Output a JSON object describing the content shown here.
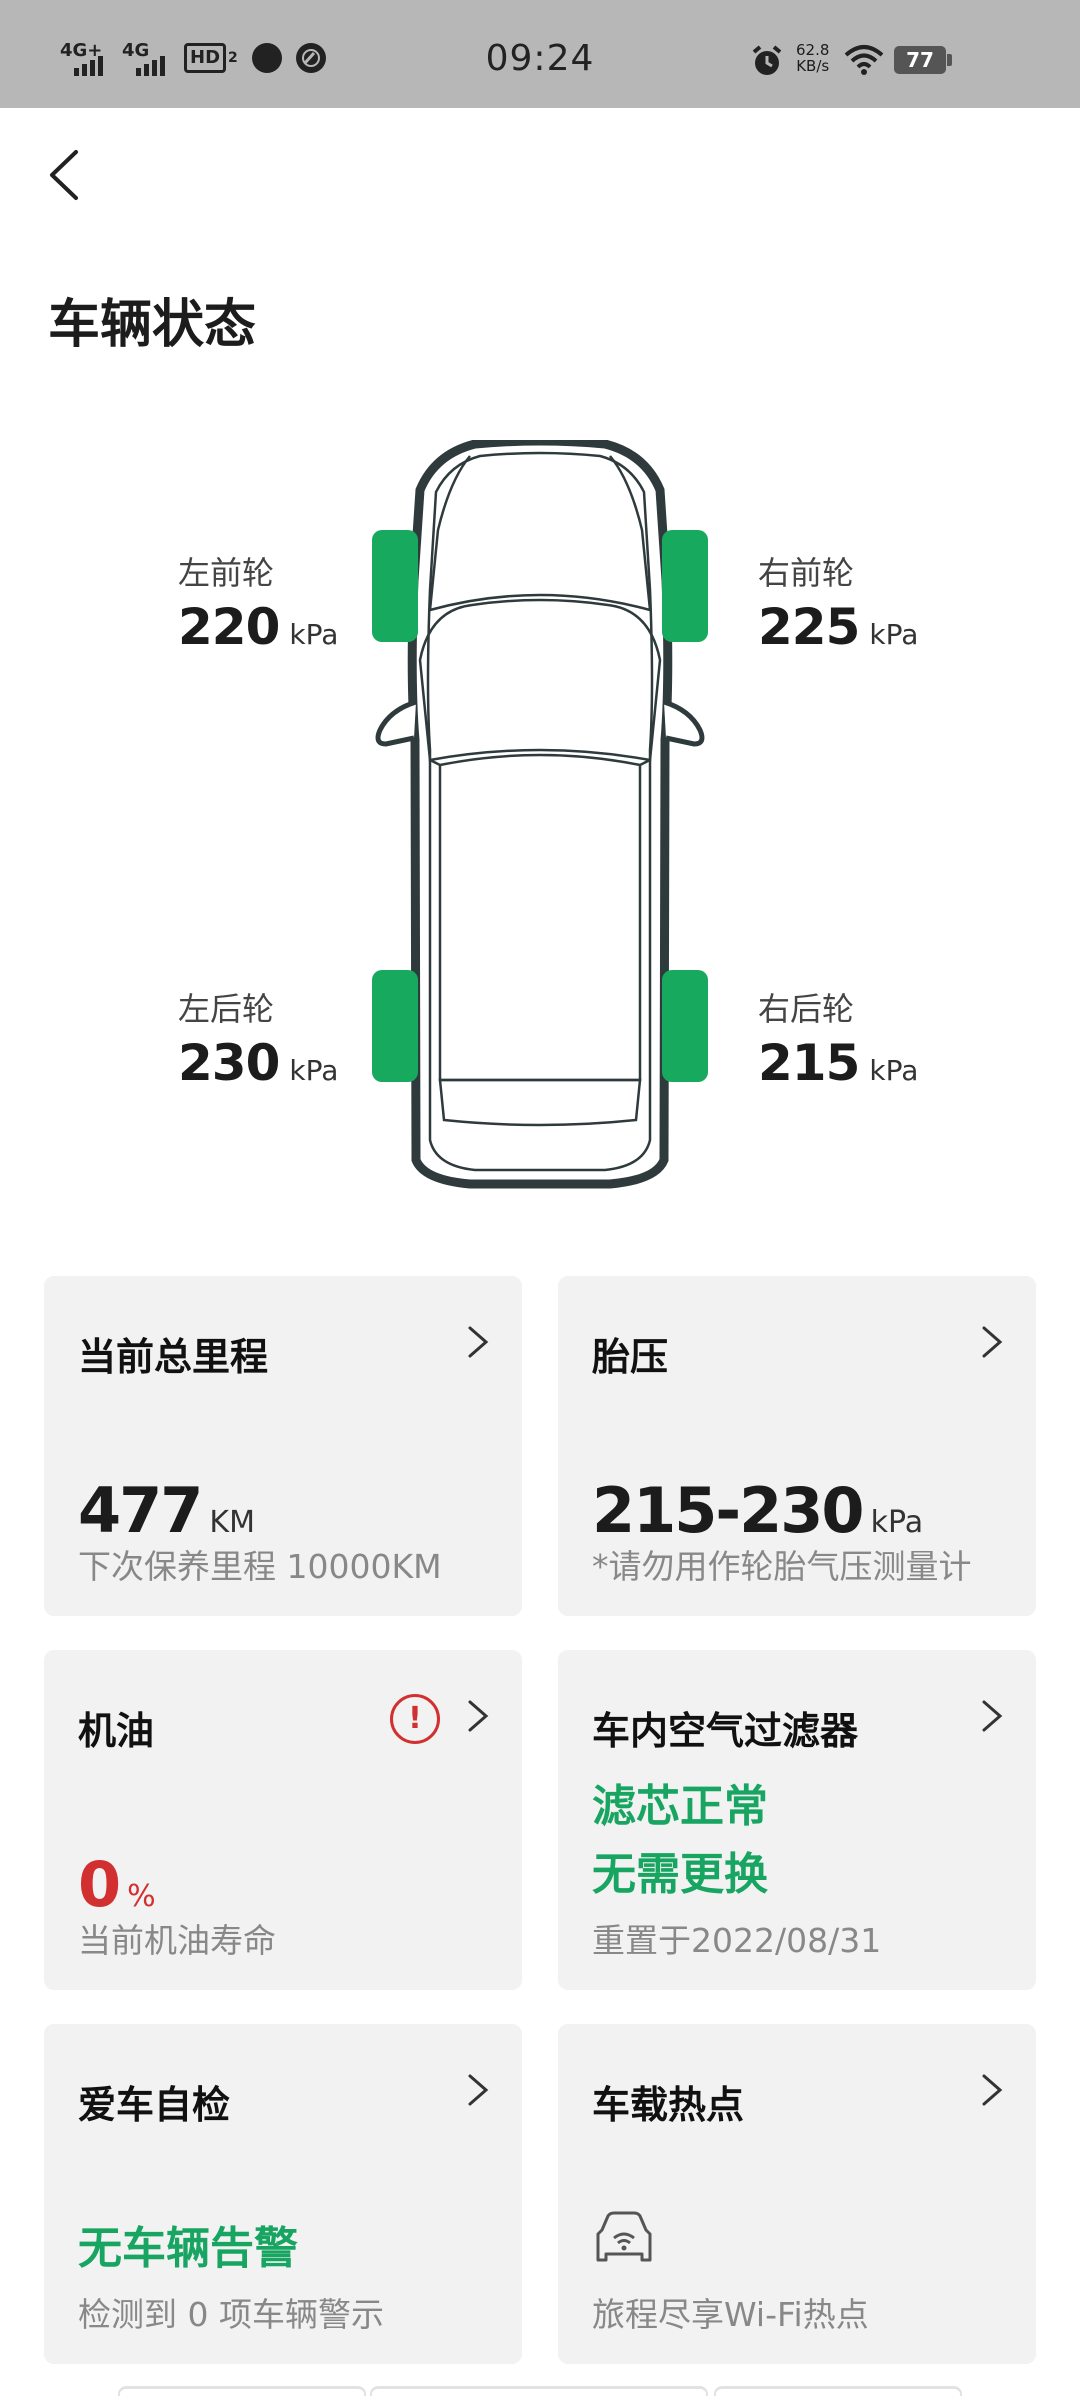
{
  "status_bar": {
    "time": "09:24",
    "sig1_label": "4G+",
    "sig2_label": "4G",
    "hd_label": "HD",
    "hd_sub": "2",
    "net_speed_value": "62.8",
    "net_speed_unit": "KB/s",
    "battery": "77",
    "icons": [
      "signal-icon",
      "hd-icon",
      "message-icon",
      "app-icon",
      "alarm-icon",
      "wifi-icon",
      "battery-icon"
    ]
  },
  "header": {
    "title": "车辆状态"
  },
  "tires": {
    "unit": "kPa",
    "front_left": {
      "label": "左前轮",
      "value": "220"
    },
    "front_right": {
      "label": "右前轮",
      "value": "225"
    },
    "rear_left": {
      "label": "左后轮",
      "value": "230"
    },
    "rear_right": {
      "label": "右后轮",
      "value": "215"
    }
  },
  "cards": {
    "mileage": {
      "title": "当前总里程",
      "value": "477",
      "unit": "KM",
      "sub": "下次保养里程 10000KM"
    },
    "tire_pressure": {
      "title": "胎压",
      "value": "215-230",
      "unit": "kPa",
      "sub": "*请勿用作轮胎气压测量计"
    },
    "oil": {
      "title": "机油",
      "value": "0",
      "unit": "%",
      "sub": "当前机油寿命",
      "warning": "!"
    },
    "air_filter": {
      "title": "车内空气过滤器",
      "status1": "滤芯正常",
      "status2": "无需更换",
      "sub": "重置于2022/08/31"
    },
    "self_check": {
      "title": "爱车自检",
      "status": "无车辆告警",
      "sub": "检测到 0 项车辆警示"
    },
    "hotspot": {
      "title": "车载热点",
      "sub": "旅程尽享Wi-Fi热点"
    }
  },
  "colors": {
    "accent_green": "#18a562",
    "tire_green": "#17aa5f",
    "warning_red": "#d23030",
    "card_bg": "#f2f2f2",
    "status_bar_bg": "#b7b7b7"
  }
}
